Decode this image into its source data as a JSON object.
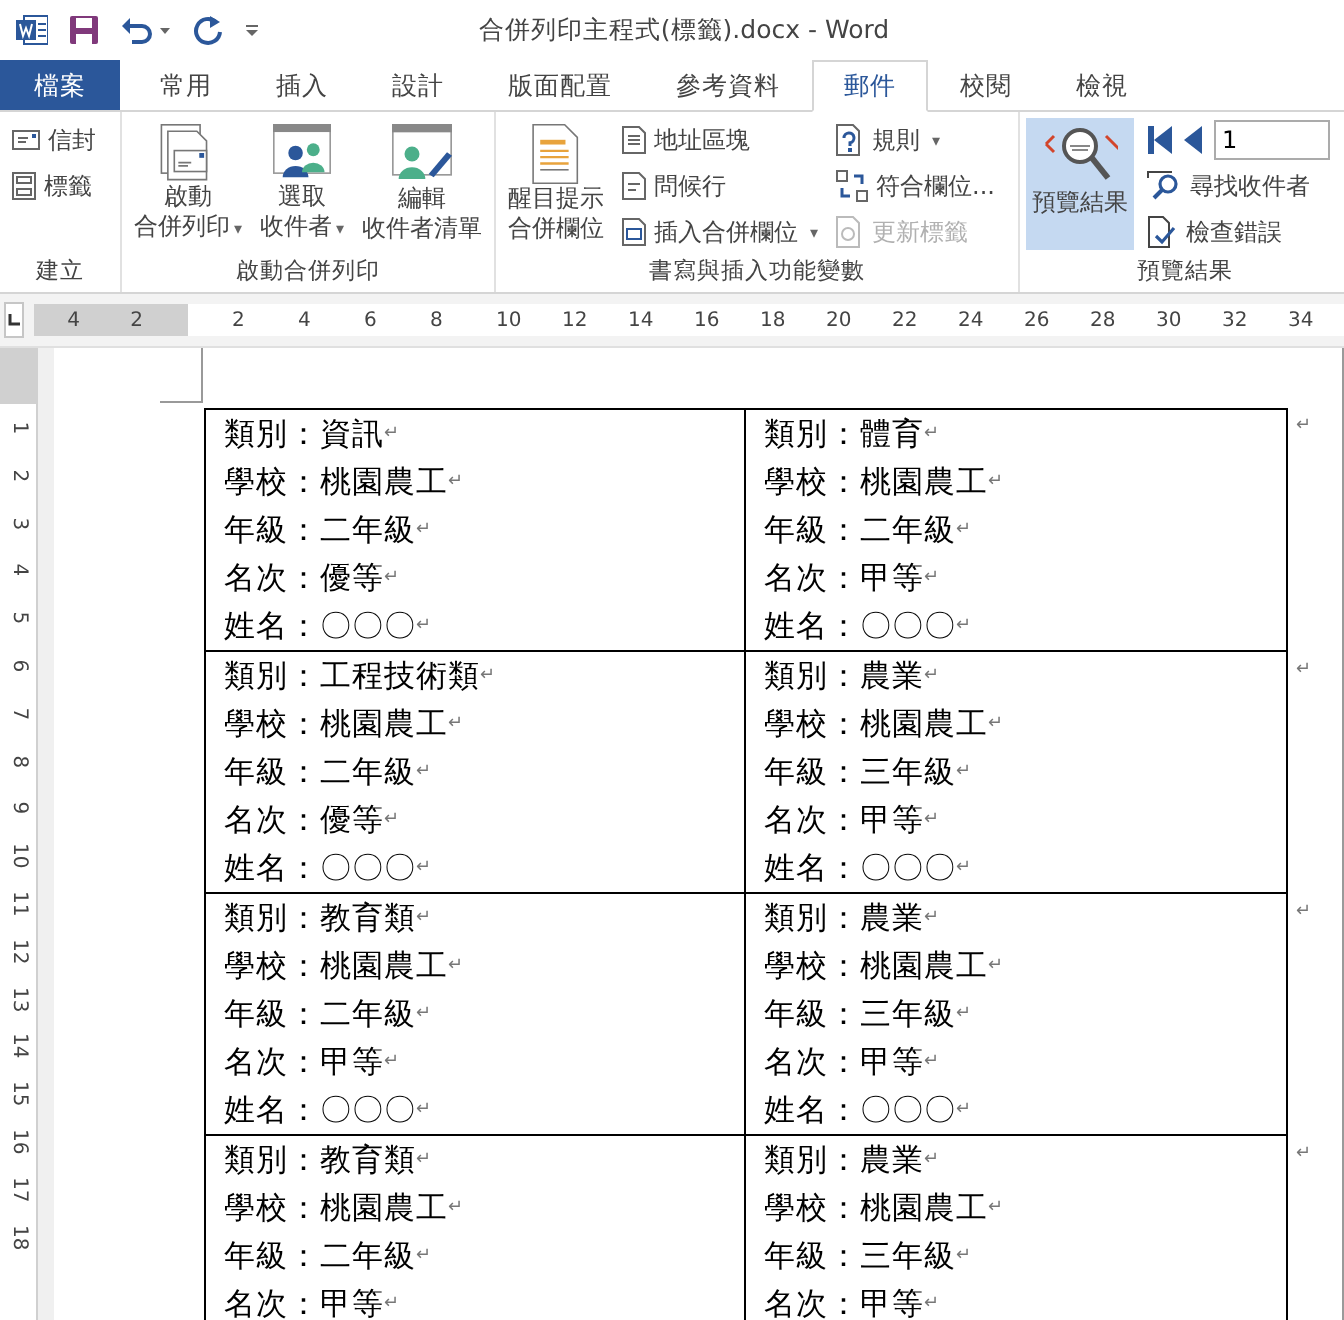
{
  "window": {
    "title": "合併列印主程式(標籤).docx - Word"
  },
  "tabs": [
    {
      "label": "檔案",
      "kind": "file",
      "selected": false
    },
    {
      "label": "常用",
      "kind": "tab",
      "selected": false
    },
    {
      "label": "插入",
      "kind": "tab",
      "selected": false
    },
    {
      "label": "設計",
      "kind": "tab",
      "selected": false
    },
    {
      "label": "版面配置",
      "kind": "tab",
      "selected": false
    },
    {
      "label": "參考資料",
      "kind": "tab",
      "selected": false
    },
    {
      "label": "郵件",
      "kind": "tab",
      "selected": true
    },
    {
      "label": "校閱",
      "kind": "tab",
      "selected": false
    },
    {
      "label": "檢視",
      "kind": "tab",
      "selected": false
    }
  ],
  "ribbon": {
    "groups": [
      {
        "label": "建立",
        "columns": [
          [
            {
              "kind": "small",
              "lines": [
                "信封"
              ],
              "disabled": false,
              "selected": false
            },
            {
              "kind": "small",
              "lines": [
                "標籤"
              ],
              "disabled": false,
              "selected": false
            }
          ]
        ]
      },
      {
        "label": "啟動合併列印",
        "columns": [
          [
            {
              "kind": "large",
              "lines": [
                "啟動",
                "合併列印"
              ],
              "caret": "▾",
              "disabled": false,
              "selected": false
            }
          ],
          [
            {
              "kind": "large",
              "lines": [
                "選取",
                "收件者"
              ],
              "caret": "▾",
              "disabled": false,
              "selected": false
            }
          ],
          [
            {
              "kind": "large",
              "lines": [
                "編輯",
                "收件者清單"
              ],
              "disabled": false,
              "selected": false
            }
          ]
        ]
      },
      {
        "label": "書寫與插入功能變數",
        "columns": [
          [
            {
              "kind": "large",
              "lines": [
                "醒目提示",
                "合併欄位"
              ],
              "disabled": false,
              "selected": false
            }
          ],
          [
            {
              "kind": "small",
              "lines": [
                "地址區塊"
              ],
              "disabled": false,
              "selected": false
            },
            {
              "kind": "small",
              "lines": [
                "問候行"
              ],
              "disabled": false,
              "selected": false
            },
            {
              "kind": "small",
              "lines": [
                "插入合併欄位"
              ],
              "caret": "▾",
              "disabled": false,
              "selected": false
            }
          ],
          [
            {
              "kind": "small",
              "lines": [
                "規則"
              ],
              "caret": "▾",
              "disabled": false,
              "selected": false
            },
            {
              "kind": "small",
              "lines": [
                "符合欄位..."
              ],
              "disabled": false,
              "selected": false
            },
            {
              "kind": "small",
              "lines": [
                "更新標籤"
              ],
              "disabled": true,
              "selected": false
            }
          ]
        ]
      },
      {
        "label": "預覽結果",
        "columns": [
          [
            {
              "kind": "large",
              "lines": [
                "預覽結果"
              ],
              "disabled": false,
              "selected": true
            }
          ],
          [
            {
              "kind": "nav",
              "lines": [
                "1"
              ],
              "disabled": false,
              "selected": false
            },
            {
              "kind": "small",
              "lines": [
                "尋找收件者"
              ],
              "disabled": false,
              "selected": false
            },
            {
              "kind": "small",
              "lines": [
                "檢查錯誤"
              ],
              "disabled": false,
              "selected": false
            }
          ]
        ]
      }
    ]
  },
  "ruler": {
    "horizontal": [
      "4",
      "2",
      "2",
      "4",
      "6",
      "8",
      "10",
      "12",
      "14",
      "16",
      "18",
      "20",
      "22",
      "24",
      "26",
      "28",
      "30",
      "32",
      "34"
    ],
    "vertical": [
      "1",
      "2",
      "3",
      "4",
      "5",
      "6",
      "7",
      "8",
      "9",
      "10",
      "11",
      "12",
      "13",
      "14",
      "15",
      "16",
      "17",
      "18"
    ]
  },
  "document": {
    "rows": [
      {
        "end_mark": "↵",
        "cells": [
          {
            "lines": [
              [
                "類別：資訊",
                "↵"
              ],
              [
                "學校：桃園農工",
                "↵"
              ],
              [
                "年級：二年級",
                "↵"
              ],
              [
                "名次：優等",
                "↵"
              ],
              [
                "姓名：〇〇〇",
                "↵"
              ]
            ]
          },
          {
            "lines": [
              [
                "類別：體育",
                "↵"
              ],
              [
                "學校：桃園農工",
                "↵"
              ],
              [
                "年級：二年級",
                "↵"
              ],
              [
                "名次：甲等",
                "↵"
              ],
              [
                "姓名：〇〇〇",
                "↵"
              ]
            ]
          }
        ]
      },
      {
        "end_mark": "↵",
        "cells": [
          {
            "lines": [
              [
                "類別：工程技術類",
                "↵"
              ],
              [
                "學校：桃園農工",
                "↵"
              ],
              [
                "年級：二年級",
                "↵"
              ],
              [
                "名次：優等",
                "↵"
              ],
              [
                "姓名：〇〇〇",
                "↵"
              ]
            ]
          },
          {
            "lines": [
              [
                "類別：農業",
                "↵"
              ],
              [
                "學校：桃園農工",
                "↵"
              ],
              [
                "年級：三年級",
                "↵"
              ],
              [
                "名次：甲等",
                "↵"
              ],
              [
                "姓名：〇〇〇",
                "↵"
              ]
            ]
          }
        ]
      },
      {
        "end_mark": "↵",
        "cells": [
          {
            "lines": [
              [
                "類別：教育類",
                "↵"
              ],
              [
                "學校：桃園農工",
                "↵"
              ],
              [
                "年級：二年級",
                "↵"
              ],
              [
                "名次：甲等",
                "↵"
              ],
              [
                "姓名：〇〇〇",
                "↵"
              ]
            ]
          },
          {
            "lines": [
              [
                "類別：農業",
                "↵"
              ],
              [
                "學校：桃園農工",
                "↵"
              ],
              [
                "年級：三年級",
                "↵"
              ],
              [
                "名次：甲等",
                "↵"
              ],
              [
                "姓名：〇〇〇",
                "↵"
              ]
            ]
          }
        ]
      },
      {
        "end_mark": "↵",
        "cells": [
          {
            "lines": [
              [
                "類別：教育類",
                "↵"
              ],
              [
                "學校：桃園農工",
                "↵"
              ],
              [
                "年級：二年級",
                "↵"
              ],
              [
                "名次：甲等",
                "↵"
              ]
            ]
          },
          {
            "lines": [
              [
                "類別：農業",
                "↵"
              ],
              [
                "學校：桃園農工",
                "↵"
              ],
              [
                "年級：三年級",
                "↵"
              ],
              [
                "名次：甲等",
                "↵"
              ]
            ]
          }
        ]
      }
    ]
  }
}
